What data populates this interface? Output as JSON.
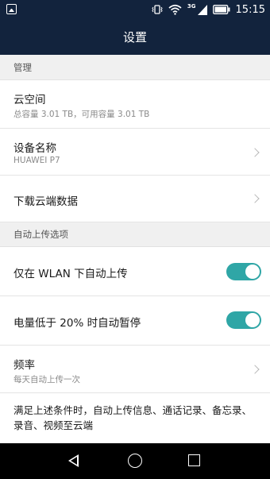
{
  "status_bar": {
    "network_label": "3G",
    "time": "15:15",
    "icons": [
      "gallery-icon",
      "vibrate-icon",
      "wifi-icon",
      "cell-signal-icon",
      "battery-icon"
    ]
  },
  "title": "设置",
  "sections": {
    "manage": {
      "header": "管理",
      "cloud_space": {
        "label": "云空间",
        "subtitle": "总容量 3.01 TB，可用容量 3.01 TB"
      },
      "device_name": {
        "label": "设备名称",
        "subtitle": "HUAWEI P7"
      },
      "download_cloud": {
        "label": "下载云端数据"
      }
    },
    "auto_upload": {
      "header": "自动上传选项",
      "wlan_only": {
        "label": "仅在 WLAN 下自动上传",
        "on": true
      },
      "battery_pause": {
        "label": "电量低于 20% 时自动暂停",
        "on": true
      },
      "frequency": {
        "label": "频率",
        "subtitle": "每天自动上传一次"
      },
      "note": "满足上述条件时，自动上传信息、通话记录、备忘录、录音、视频至云端"
    }
  },
  "nav_bar": [
    "back-icon",
    "home-icon",
    "recent-apps-icon"
  ],
  "colors": {
    "bar": "#12233d",
    "toggle_on": "#2fa6a6",
    "background": "#ffffff",
    "section_header": "#f0f0f0"
  }
}
